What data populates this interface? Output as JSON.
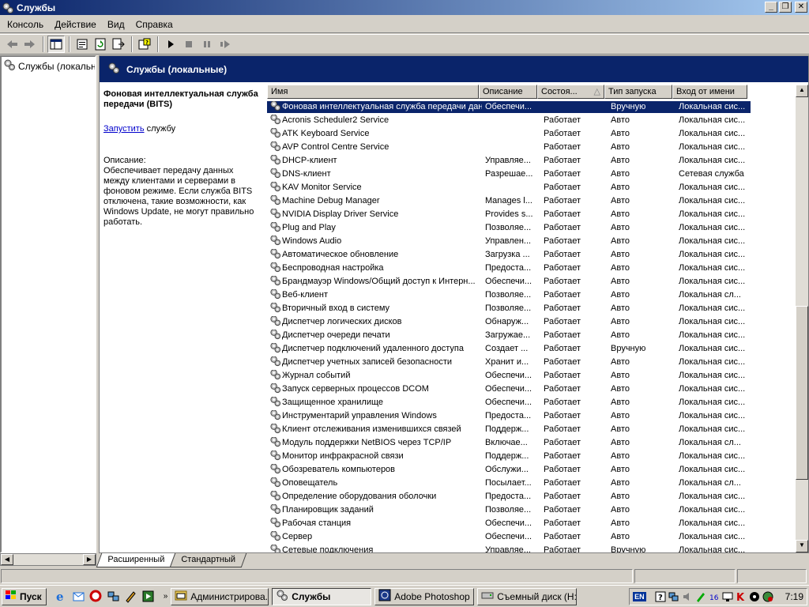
{
  "window": {
    "title": "Службы"
  },
  "menu": [
    "Консоль",
    "Действие",
    "Вид",
    "Справка"
  ],
  "tree": {
    "root_label": "Службы (локальны"
  },
  "header": {
    "title": "Службы (локальные)"
  },
  "detail": {
    "service_title": "Фоновая интеллектуальная служба передачи (BITS)",
    "start_link": "Запустить",
    "start_suffix": " службу",
    "desc_label": "Описание:",
    "desc_text": "Обеспечивает передачу данных между клиентами и серверами в фоновом режиме. Если служба BITS отключена, такие возможности, как Windows Update, не могут правильно работать."
  },
  "columns": {
    "name": "Имя",
    "description": "Описание",
    "state": "Состоя...",
    "startup": "Тип запуска",
    "logon": "Вход от имени"
  },
  "services": [
    {
      "name": "Фоновая интеллектуальная служба передачи данных (BITS)",
      "desc": "Обеспечи...",
      "state": "",
      "start": "Вручную",
      "logon": "Локальная сис...",
      "selected": true
    },
    {
      "name": "Acronis Scheduler2 Service",
      "desc": "",
      "state": "Работает",
      "start": "Авто",
      "logon": "Локальная сис..."
    },
    {
      "name": "ATK Keyboard Service",
      "desc": "",
      "state": "Работает",
      "start": "Авто",
      "logon": "Локальная сис..."
    },
    {
      "name": "AVP Control Centre Service",
      "desc": "",
      "state": "Работает",
      "start": "Авто",
      "logon": "Локальная сис..."
    },
    {
      "name": "DHCP-клиент",
      "desc": "Управляе...",
      "state": "Работает",
      "start": "Авто",
      "logon": "Локальная сис..."
    },
    {
      "name": "DNS-клиент",
      "desc": "Разрешае...",
      "state": "Работает",
      "start": "Авто",
      "logon": "Сетевая служба"
    },
    {
      "name": "KAV Monitor Service",
      "desc": "",
      "state": "Работает",
      "start": "Авто",
      "logon": "Локальная сис..."
    },
    {
      "name": "Machine Debug Manager",
      "desc": "Manages l...",
      "state": "Работает",
      "start": "Авто",
      "logon": "Локальная сис..."
    },
    {
      "name": "NVIDIA Display Driver Service",
      "desc": "Provides s...",
      "state": "Работает",
      "start": "Авто",
      "logon": "Локальная сис..."
    },
    {
      "name": "Plug and Play",
      "desc": "Позволяе...",
      "state": "Работает",
      "start": "Авто",
      "logon": "Локальная сис..."
    },
    {
      "name": "Windows Audio",
      "desc": "Управлен...",
      "state": "Работает",
      "start": "Авто",
      "logon": "Локальная сис..."
    },
    {
      "name": "Автоматическое обновление",
      "desc": "Загрузка ...",
      "state": "Работает",
      "start": "Авто",
      "logon": "Локальная сис..."
    },
    {
      "name": "Беспроводная настройка",
      "desc": "Предоста...",
      "state": "Работает",
      "start": "Авто",
      "logon": "Локальная сис..."
    },
    {
      "name": "Брандмауэр Windows/Общий доступ к Интерн...",
      "desc": "Обеспечи...",
      "state": "Работает",
      "start": "Авто",
      "logon": "Локальная сис..."
    },
    {
      "name": "Веб-клиент",
      "desc": "Позволяе...",
      "state": "Работает",
      "start": "Авто",
      "logon": "Локальная сл..."
    },
    {
      "name": "Вторичный вход в систему",
      "desc": "Позволяе...",
      "state": "Работает",
      "start": "Авто",
      "logon": "Локальная сис..."
    },
    {
      "name": "Диспетчер логических дисков",
      "desc": "Обнаруж...",
      "state": "Работает",
      "start": "Авто",
      "logon": "Локальная сис..."
    },
    {
      "name": "Диспетчер очереди печати",
      "desc": "Загружае...",
      "state": "Работает",
      "start": "Авто",
      "logon": "Локальная сис..."
    },
    {
      "name": "Диспетчер подключений удаленного доступа",
      "desc": "Создает ...",
      "state": "Работает",
      "start": "Вручную",
      "logon": "Локальная сис..."
    },
    {
      "name": "Диспетчер учетных записей безопасности",
      "desc": "Хранит и...",
      "state": "Работает",
      "start": "Авто",
      "logon": "Локальная сис..."
    },
    {
      "name": "Журнал событий",
      "desc": "Обеспечи...",
      "state": "Работает",
      "start": "Авто",
      "logon": "Локальная сис..."
    },
    {
      "name": "Запуск серверных процессов DCOM",
      "desc": "Обеспечи...",
      "state": "Работает",
      "start": "Авто",
      "logon": "Локальная сис..."
    },
    {
      "name": "Защищенное хранилище",
      "desc": "Обеспечи...",
      "state": "Работает",
      "start": "Авто",
      "logon": "Локальная сис..."
    },
    {
      "name": "Инструментарий управления Windows",
      "desc": "Предоста...",
      "state": "Работает",
      "start": "Авто",
      "logon": "Локальная сис..."
    },
    {
      "name": "Клиент отслеживания изменившихся связей",
      "desc": "Поддерж...",
      "state": "Работает",
      "start": "Авто",
      "logon": "Локальная сис..."
    },
    {
      "name": "Модуль поддержки NetBIOS через TCP/IP",
      "desc": "Включае...",
      "state": "Работает",
      "start": "Авто",
      "logon": "Локальная сл..."
    },
    {
      "name": "Монитор инфракрасной связи",
      "desc": "Поддерж...",
      "state": "Работает",
      "start": "Авто",
      "logon": "Локальная сис..."
    },
    {
      "name": "Обозреватель компьютеров",
      "desc": "Обслужи...",
      "state": "Работает",
      "start": "Авто",
      "logon": "Локальная сис..."
    },
    {
      "name": "Оповещатель",
      "desc": "Посылает...",
      "state": "Работает",
      "start": "Авто",
      "logon": "Локальная сл..."
    },
    {
      "name": "Определение оборудования оболочки",
      "desc": "Предоста...",
      "state": "Работает",
      "start": "Авто",
      "logon": "Локальная сис..."
    },
    {
      "name": "Планировщик заданий",
      "desc": "Позволяе...",
      "state": "Работает",
      "start": "Авто",
      "logon": "Локальная сис..."
    },
    {
      "name": "Рабочая станция",
      "desc": "Обеспечи...",
      "state": "Работает",
      "start": "Авто",
      "logon": "Локальная сис..."
    },
    {
      "name": "Сервер",
      "desc": "Обеспечи...",
      "state": "Работает",
      "start": "Авто",
      "logon": "Локальная сис..."
    },
    {
      "name": "Сетевые подключения",
      "desc": "Управляе...",
      "state": "Работает",
      "start": "Вручную",
      "logon": "Локальная сис..."
    }
  ],
  "tabs": {
    "extended": "Расширенный",
    "standard": "Стандартный"
  },
  "taskbar": {
    "start_label": "Пуск",
    "tasks": [
      "Администрирова...",
      "Службы",
      "Adobe Photoshop",
      "Съемный диск (H:)"
    ],
    "lang": "EN",
    "clock": "7:19"
  },
  "colors": {
    "titlebar": "#0a246a",
    "selection": "#0a246a",
    "face": "#d4d0c8"
  }
}
